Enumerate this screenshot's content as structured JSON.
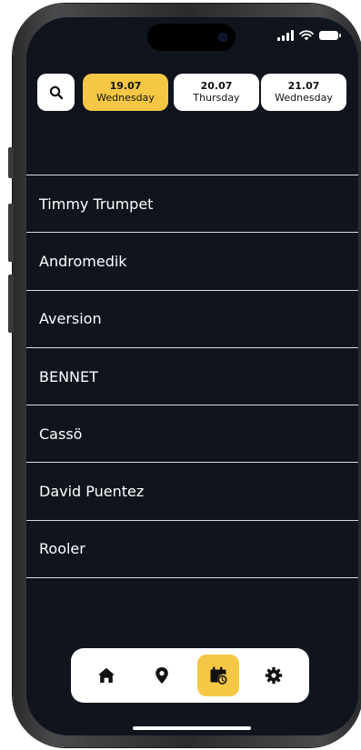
{
  "status_bar": {
    "icons": [
      "signal-icon",
      "wifi-icon",
      "battery-icon"
    ]
  },
  "header": {
    "search_icon": "search-icon",
    "dates": [
      {
        "date": "19.07",
        "weekday": "Wednesday",
        "active": true
      },
      {
        "date": "20.07",
        "weekday": "Thursday",
        "active": false
      },
      {
        "date": "21.07",
        "weekday": "Wednesday",
        "active": false
      }
    ]
  },
  "artists": [
    "Timmy Trumpet",
    "Andromedik",
    "Aversion",
    "BENNET",
    "Cassö",
    "David Puentez",
    "Rooler"
  ],
  "bottom_nav": {
    "items": [
      {
        "icon": "home-icon",
        "active": false
      },
      {
        "icon": "location-pin-icon",
        "active": false
      },
      {
        "icon": "calendar-clock-icon",
        "active": true
      },
      {
        "icon": "gear-icon",
        "active": false
      }
    ]
  },
  "colors": {
    "background": "#0f141d",
    "accent": "#f6c744",
    "divider": "#d9dbe0",
    "text": "#ffffff"
  }
}
